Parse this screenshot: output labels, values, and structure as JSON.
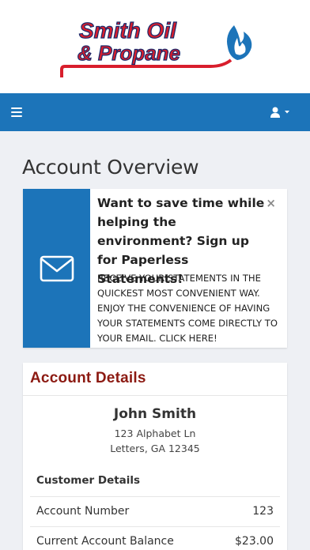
{
  "brand": {
    "line1": "Smith Oil",
    "line2": "& Propane",
    "red": "#d81e2c",
    "blue": "#1c74b9"
  },
  "nav": {
    "menu_icon": "hamburger-icon",
    "user_icon": "user-icon",
    "dropdown_icon": "caret-down-icon"
  },
  "page": {
    "title": "Account Overview"
  },
  "promo": {
    "icon": "envelope-icon",
    "heading": "Want to save time while helping the environment? Sign up for Paperless Statements!",
    "body": "Receive your statements in the quickest most convenient way. Enjoy the convenience of having your statements come directly to your email. Click here!",
    "close": "×"
  },
  "account": {
    "header": "Account Details",
    "name": "John Smith",
    "address1": "123 Alphabet Ln",
    "address2": "Letters, GA 12345",
    "section": "Customer Details",
    "rows": [
      {
        "label": "Account Number",
        "value": "123"
      },
      {
        "label": "Current Account Balance",
        "value": "$23.00"
      }
    ]
  }
}
